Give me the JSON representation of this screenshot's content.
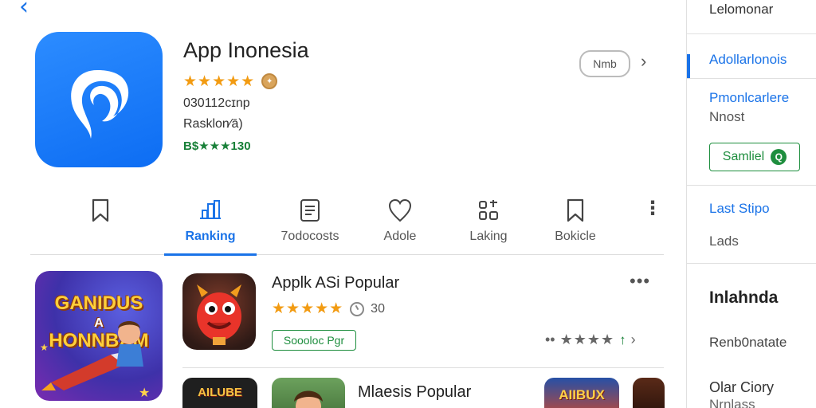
{
  "app": {
    "title": "App Inonesia",
    "stars": "★★★★★",
    "meta1": "030112ᴄɪnp",
    "meta2": "Rasklon⁄ā)",
    "meta3": "B$★★★130",
    "pill_label": "Nmb",
    "share_icon": "share-icon"
  },
  "tabs": [
    {
      "label": "Ranking",
      "active": true,
      "icon": "ranking-icon"
    },
    {
      "label": "7odocosts",
      "active": false,
      "icon": "document-icon"
    },
    {
      "label": "Adole",
      "active": false,
      "icon": "heart-icon"
    },
    {
      "label": "Laking",
      "active": false,
      "icon": "grid-icon"
    },
    {
      "label": "Bokicle",
      "active": false,
      "icon": "bookmark-icon"
    }
  ],
  "feature": {
    "line1": "GANIDUS",
    "line2": "A",
    "line3": "HONNBAM"
  },
  "row1": {
    "title": "Applk ASi Popular",
    "stars": "★★★★★",
    "count": "30",
    "tag": "Soooloc Pgr",
    "more": "•••",
    "rating_prefix": "••",
    "rating_stars": "★★★★",
    "rating_suffix": "↑",
    "rating_chevron": "›"
  },
  "row2": {
    "title": "Mlaesis Popular",
    "thumb1_text": "AILUBE",
    "thumb3_text": "AIIBUX"
  },
  "sidebar": {
    "header": "Lelomonar",
    "item_active": "Adollarlonois",
    "item2_title": "Pmonlcarlere",
    "item2_sub": "Nnost",
    "button_label": "Samliel",
    "button_icon": "Q",
    "item3_title": "Last Stipo",
    "item3_sub": "Lads",
    "section_title": "Inlahnda",
    "item4": "Renb0natate",
    "item5_title": "Olar Ciory",
    "item5_sub": "Nrnlass"
  },
  "colors": {
    "accent": "#1a73e8",
    "green": "#1e8e3e",
    "star": "#f29b12",
    "icon_blue": "#0d6df3"
  }
}
